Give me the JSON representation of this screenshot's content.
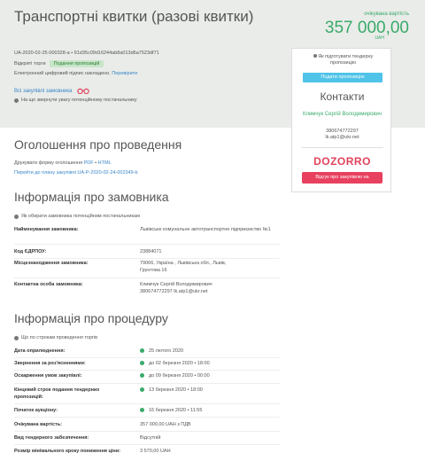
{
  "header": {
    "title": "Транспортні квитки (разові квитки)",
    "expected_label": "очікувана вартість",
    "expected_value": "357 000,00",
    "currency": "UAH"
  },
  "tender": {
    "id": "UA-2020-02-25-000328-a • 91d35c09d16244ab8a013d6a7523df71",
    "status_label": "Відкриті торги",
    "status_badge": "Подання пропозицій",
    "signature_text": "Електронний цифровий підпис накладено.",
    "signature_link": "Перевірити",
    "all_buyer_tenders": "Всі закупівлі замовника",
    "hint": "На що звернути увагу потенційному постачальнику"
  },
  "sidebar": {
    "not_signed": "Як підготувати тендерну пропозицію",
    "apply_button": "Подати пропозицію",
    "contacts_title": "Контакти",
    "contact_name": "Климчук Сергій Володимирович",
    "contact_phone": "380674772297",
    "contact_email": "lk.atp1@ukr.net",
    "dozorro_logo": "DOZORRO",
    "review_button": "Відгук про закупівлю на"
  },
  "announcement": {
    "title": "Оголошення про проведення",
    "print_label": "Друкувати форму оголошення",
    "print_pdf": "PDF",
    "print_html": "HTML",
    "plan_link": "Перейти до плану закупівлі UA-P-2020-02-24-002349-b"
  },
  "buyer": {
    "title": "Інформація про замовника",
    "hint": "Як обирати замовника потенційним постачальникам",
    "rows": [
      {
        "label": "Найменування замовника:",
        "value": "Львівське комунальне автотранспортне підприємство №1"
      },
      {
        "label": "Код ЄДРПОУ:",
        "value": "23884071"
      },
      {
        "label": "Місцезнаходження замовника:",
        "value": "79066, Україна , Львівська обл., Львів, Грунтова 16"
      },
      {
        "label": "Контактна особа замовника:",
        "value": "Климчук Сергій Володимирович 380674772297 lk.atp1@ukr.net"
      }
    ]
  },
  "procedure": {
    "title": "Інформація про процедуру",
    "hint": "Що по строкам проведення торгів",
    "rows": [
      {
        "label": "Дата оприлюднення:",
        "value": "25 лютого 2020"
      },
      {
        "label": "Звернення за роз'ясненнями:",
        "value": "до 02 березня 2020 • 18:00"
      },
      {
        "label": "Оскарження умов закупівлі:",
        "value": "до 09 березня 2020 • 00:00"
      },
      {
        "label": "Кінцевий строк подання тендерних пропозицій:",
        "value": "13 березня 2020 • 18:00"
      },
      {
        "label": "Початок аукціону:",
        "value": "16 березня 2020 • 11:55"
      },
      {
        "label": "Очікувана вартість:",
        "value": "357 000,00 UAH з ПДВ"
      },
      {
        "label": "Вид тендерного забезпечення:",
        "value": "Відсутній"
      },
      {
        "label": "Розмір мінімального кроку пониження ціни:",
        "value": "3 570,00 UAH"
      }
    ]
  },
  "colors": {
    "accent_green": "#3aaa6a",
    "link_blue": "#3a86c8",
    "dozorro_red": "#e8405f"
  }
}
